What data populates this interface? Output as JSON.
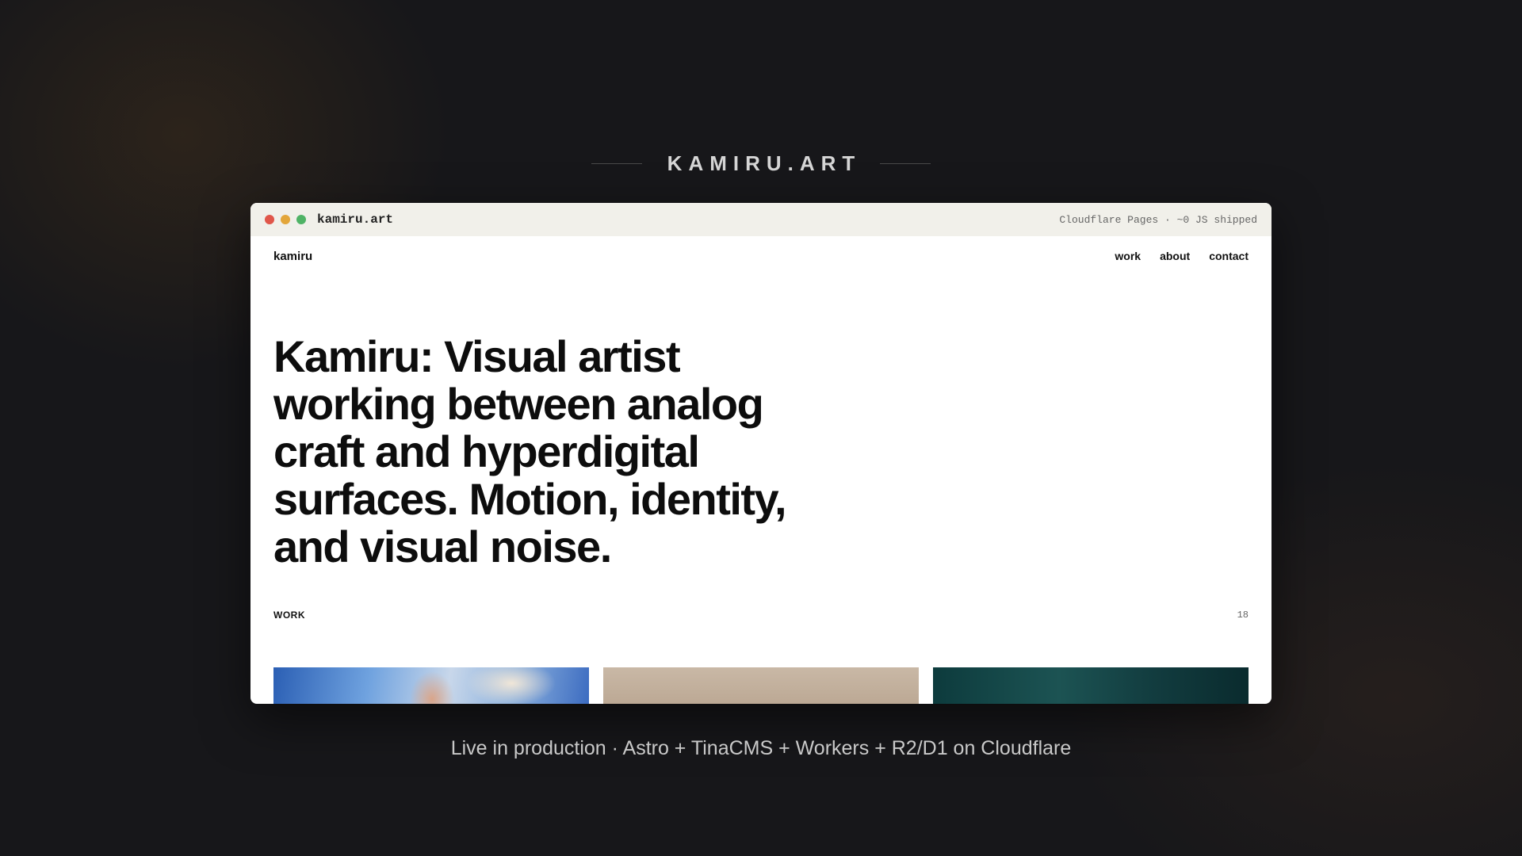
{
  "header": {
    "title": "KAMIRU.ART"
  },
  "browser": {
    "url": "kamiru.art",
    "host_info": "Cloudflare Pages · ~0 JS shipped",
    "controls": [
      {
        "name": "close",
        "color": "#e0564a"
      },
      {
        "name": "minimize",
        "color": "#e3a63a"
      },
      {
        "name": "maximize",
        "color": "#4fb366"
      }
    ]
  },
  "site": {
    "brand": "kamiru",
    "nav": [
      {
        "label": "work"
      },
      {
        "label": "about"
      },
      {
        "label": "contact"
      }
    ],
    "hero": "Kamiru: Visual artist working between analog craft and hyperdigital surfaces. Motion, identity, and visual noise.",
    "work": {
      "label": "WORK",
      "count": "18"
    }
  },
  "footer": {
    "caption": "Live in production · Astro + TinaCMS + Workers + R2/D1 on Cloudflare"
  }
}
